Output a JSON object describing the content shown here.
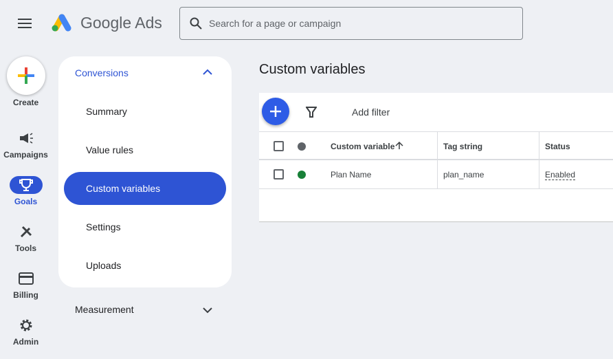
{
  "header": {
    "brand": "Google Ads",
    "search_placeholder": "Search for a page or campaign"
  },
  "rail": {
    "create": "Create",
    "items": [
      {
        "label": "Campaigns"
      },
      {
        "label": "Goals"
      },
      {
        "label": "Tools"
      },
      {
        "label": "Billing"
      },
      {
        "label": "Admin"
      }
    ]
  },
  "nav": {
    "section": "Conversions",
    "items": [
      "Summary",
      "Value rules",
      "Custom variables",
      "Settings",
      "Uploads"
    ],
    "section2": "Measurement"
  },
  "main": {
    "title": "Custom variables",
    "add_filter": "Add filter",
    "columns": [
      "Custom variable",
      "Tag string",
      "Status"
    ],
    "rows": [
      {
        "name": "Plan Name",
        "tag": "plan_name",
        "status": "Enabled"
      }
    ]
  },
  "colors": {
    "accent": "#2e54d4",
    "enabled": "#188038"
  }
}
